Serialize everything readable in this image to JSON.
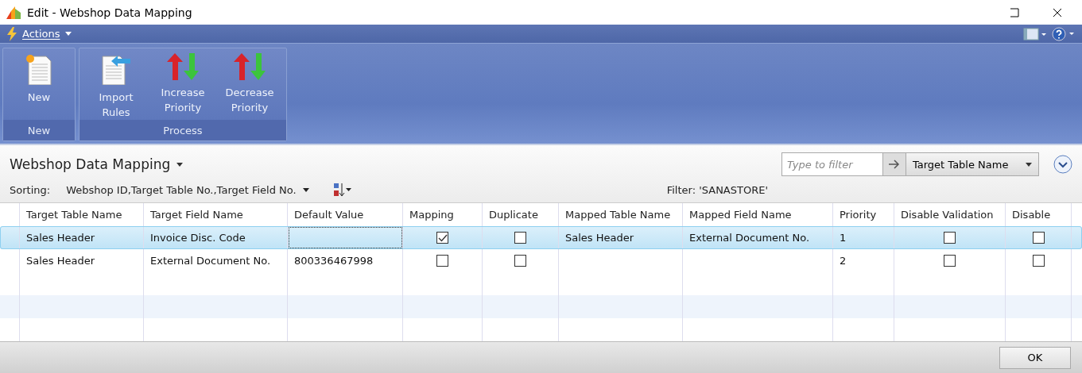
{
  "window": {
    "title": "Edit - Webshop Data Mapping"
  },
  "actions_bar": {
    "label": "Actions"
  },
  "ribbon": [
    {
      "label": "New",
      "buttons": [
        {
          "label": "New",
          "kind": "new"
        }
      ]
    },
    {
      "label": "Process",
      "buttons": [
        {
          "label": "Import Rules",
          "kind": "import"
        },
        {
          "label": "Increase Priority",
          "kind": "priority"
        },
        {
          "label": "Decrease Priority",
          "kind": "priority"
        }
      ]
    }
  ],
  "page": {
    "title": "Webshop Data Mapping",
    "sorting_label": "Sorting:",
    "sorting_value": "Webshop ID,Target Table No.,Target Field No.",
    "filter_text": "Filter: 'SANASTORE'",
    "filter_field": {
      "placeholder": "Type to filter"
    },
    "filter_column": "Target Table Name"
  },
  "table": {
    "columns": [
      {
        "label": "Target Table Name",
        "kind": "text"
      },
      {
        "label": "Target Field Name",
        "kind": "text"
      },
      {
        "label": "Default Value",
        "kind": "text"
      },
      {
        "label": "Mapping",
        "kind": "check"
      },
      {
        "label": "Duplicate",
        "kind": "check"
      },
      {
        "label": "Mapped Table Name",
        "kind": "text"
      },
      {
        "label": "Mapped Field Name",
        "kind": "text"
      },
      {
        "label": "Priority",
        "kind": "text"
      },
      {
        "label": "Disable Validation",
        "kind": "check"
      },
      {
        "label": "Disable",
        "kind": "check"
      }
    ],
    "rows": [
      {
        "selected": true,
        "cells": [
          {
            "text": "Sales Header"
          },
          {
            "text": "Invoice Disc. Code"
          },
          {
            "focused": true
          },
          {
            "checked": true
          },
          {
            "checked": false
          },
          {
            "text": "Sales Header"
          },
          {
            "text": "External Document No."
          },
          {
            "text": "1"
          },
          {
            "checked": false
          },
          {
            "checked": false
          }
        ]
      },
      {
        "selected": false,
        "cells": [
          {
            "text": "Sales Header"
          },
          {
            "text": "External Document No."
          },
          {
            "text": "800336467998"
          },
          {
            "checked": false
          },
          {
            "checked": false
          },
          {},
          {},
          {
            "text": "2"
          },
          {
            "checked": false
          },
          {
            "checked": false
          }
        ]
      }
    ]
  },
  "footer": {
    "ok_button": "OK"
  }
}
